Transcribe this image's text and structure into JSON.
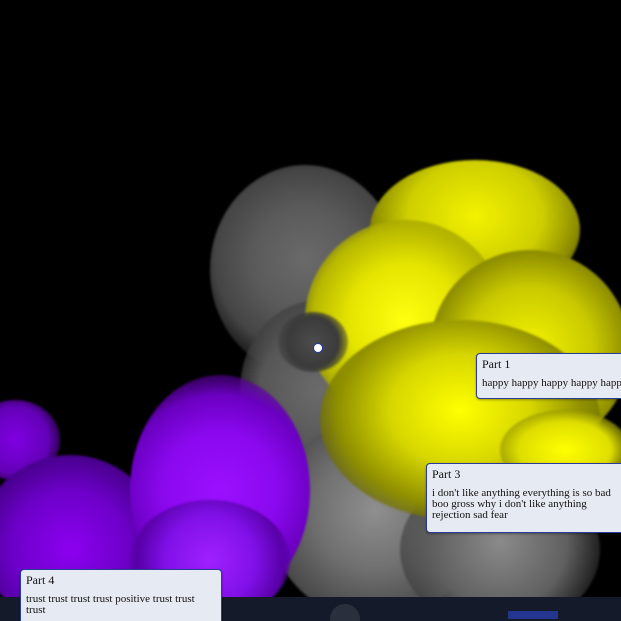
{
  "visualization": {
    "colors": {
      "background": "#000000",
      "gray": "#6a6a6a",
      "yellow": "#ffff00",
      "purple": "#8c00f0",
      "tooltip_background": "#e6eaf2",
      "tooltip_border": "#2b3b9a",
      "marker": "#ffffff"
    }
  },
  "tooltips": [
    {
      "title": "Part 1",
      "text": "happy happy happy happy happy"
    },
    {
      "title": "Part 3",
      "text": "i don't like anything everything is so bad boo gross why i don't like anything rejection sad fear"
    },
    {
      "title": "Part 4",
      "text": "trust trust trust trust positive trust trust trust"
    }
  ]
}
